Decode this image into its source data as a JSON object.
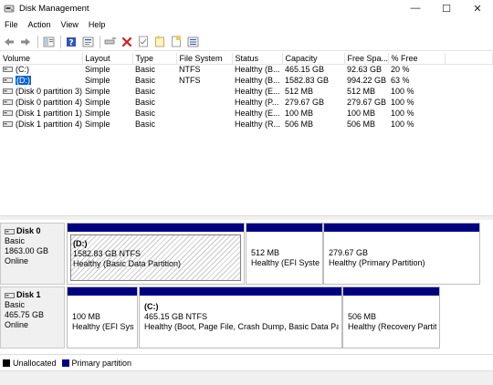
{
  "window": {
    "title": "Disk Management",
    "controls": {
      "minimize": "—",
      "maximize": "☐",
      "close": "✕"
    }
  },
  "menu": [
    "File",
    "Action",
    "View",
    "Help"
  ],
  "toolbar": {
    "buttons": [
      "back-icon",
      "forward-icon",
      "up-icon",
      "help-icon",
      "properties-icon",
      "connect-icon",
      "delete-icon",
      "check-icon",
      "folder-icon",
      "new-icon",
      "list-icon"
    ]
  },
  "volume_table": {
    "columns": [
      "Volume",
      "Layout",
      "Type",
      "File System",
      "Status",
      "Capacity",
      "Free Spa...",
      "% Free"
    ],
    "rows": [
      [
        "(C:)",
        "Simple",
        "Basic",
        "NTFS",
        "Healthy (B...",
        "465.15 GB",
        "92.63 GB",
        "20 %"
      ],
      [
        "(D:)",
        "Simple",
        "Basic",
        "NTFS",
        "Healthy (B...",
        "1582.83 GB",
        "994.22 GB",
        "63 %"
      ],
      [
        "(Disk 0 partition 3)",
        "Simple",
        "Basic",
        "",
        "Healthy (E...",
        "512 MB",
        "512 MB",
        "100 %"
      ],
      [
        "(Disk 0 partition 4)",
        "Simple",
        "Basic",
        "",
        "Healthy (P...",
        "279.67 GB",
        "279.67 GB",
        "100 %"
      ],
      [
        "(Disk 1 partition 1)",
        "Simple",
        "Basic",
        "",
        "Healthy (E...",
        "100 MB",
        "100 MB",
        "100 %"
      ],
      [
        "(Disk 1 partition 4)",
        "Simple",
        "Basic",
        "",
        "Healthy (R...",
        "506 MB",
        "506 MB",
        "100 %"
      ]
    ],
    "selected_row": 1
  },
  "disks": [
    {
      "name": "Disk 0",
      "type": "Basic",
      "size": "1863.00 GB",
      "status": "Online",
      "partitions": [
        {
          "title": "(D:)",
          "size_fs": "1582.83 GB NTFS",
          "status": "Healthy (Basic Data Partition)",
          "selected": true
        },
        {
          "title": "",
          "size_fs": "512 MB",
          "status": "Healthy (EFI System",
          "selected": false
        },
        {
          "title": "",
          "size_fs": "279.67 GB",
          "status": "Healthy (Primary Partition)",
          "selected": false
        }
      ]
    },
    {
      "name": "Disk 1",
      "type": "Basic",
      "size": "465.75 GB",
      "status": "Online",
      "partitions": [
        {
          "title": "",
          "size_fs": "100 MB",
          "status": "Healthy (EFI Syste",
          "selected": false
        },
        {
          "title": "(C:)",
          "size_fs": "465.15 GB NTFS",
          "status": "Healthy (Boot, Page File, Crash Dump, Basic Data Partitio",
          "selected": false
        },
        {
          "title": "",
          "size_fs": "506 MB",
          "status": "Healthy (Recovery Partitic",
          "selected": false
        }
      ]
    }
  ],
  "legend": [
    {
      "label": "Unallocated",
      "color": "#000000"
    },
    {
      "label": "Primary partition",
      "color": "#000080"
    }
  ],
  "colors": {
    "partition_bar": "#000080",
    "selection": "#0a64d0"
  }
}
